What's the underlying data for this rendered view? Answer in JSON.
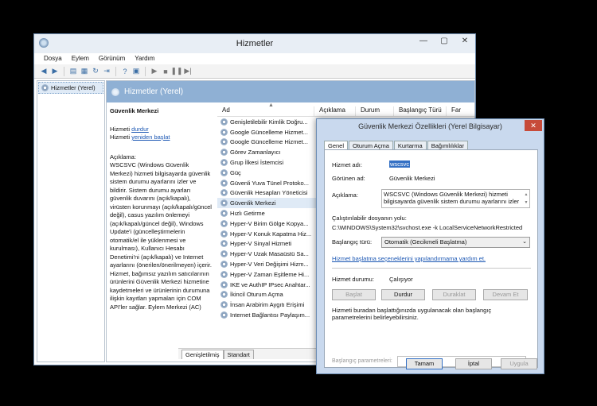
{
  "main": {
    "title": "Hizmetler",
    "menu": [
      "Dosya",
      "Eylem",
      "Görünüm",
      "Yardım"
    ],
    "tree_item": "Hizmetler (Yerel)",
    "content_header": "Hizmetler (Yerel)",
    "desc": {
      "title": "Güvenlik Merkezi",
      "stop_prefix": "Hizmeti ",
      "stop_link": "durdur",
      "restart_prefix": "Hizmeti ",
      "restart_link": "yeniden başlat",
      "label": "Açıklama:",
      "text": "WSCSVC (Windows Güvenlik Merkezi) hizmeti bilgisayarda güvenlik sistem durumu ayarlarını izler ve bildirir. Sistem durumu ayarları güvenlik duvarını (açık/kapalı), virüsten korunmayı (açık/kapalı/güncel değil), casus yazılım önlemeyi (açık/kapalı/güncel değil), Windows Update'i (güncelleştirmelerin otomatik/el ile yüklenmesi ve kurulması), Kullanıcı Hesabı Denetimi'ni (açık/kapalı) ve Internet ayarlarını (önerilen/önerilmeyen) içerir. Hizmet, bağımsız yazılım satıcılarının ürünlerini Güvenlik Merkezi hizmetine kaydetmeleri ve ürünlerinin durumuna ilişkin kayıtları yapmaları için COM API'ler sağlar. Eylem Merkezi (AC)"
    },
    "columns": [
      "Ad",
      "Açıklama",
      "Durum",
      "Başlangıç Türü",
      "Far"
    ],
    "services": [
      "Genişletilebilir Kimlik Doğru...",
      "Google Güncelleme Hizmet...",
      "Google Güncelleme Hizmet...",
      "Görev Zamanlayıcı",
      "Grup İlkesi İstemcisi",
      "Güç",
      "Güvenli Yuva Tünel Protoko...",
      "Güvenlik Hesapları Yöneticisi",
      "Güvenlik Merkezi",
      "Hızlı Getirme",
      "Hyper-V Birim Gölge Kopya...",
      "Hyper-V Konuk Kapatma Hiz...",
      "Hyper-V Sinyal Hizmeti",
      "Hyper-V Uzak Masaüstü Sa...",
      "Hyper-V Veri Değişimi Hizm...",
      "Hyper-V Zaman Eşitleme Hi...",
      "IKE ve AuthIP IPsec Anahtar...",
      "İkincil Oturum Açma",
      "İnsan Arabirim Aygıtı Erişimi",
      "Internet Bağlantısı Paylaşım..."
    ],
    "selected_index": 8,
    "tabs": [
      "Genişletilmiş",
      "Standart"
    ]
  },
  "dialog": {
    "title": "Güvenlik Merkezi Özellikleri (Yerel Bilgisayar)",
    "close": "✕",
    "tabs": [
      "Genel",
      "Oturum Açma",
      "Kurtarma",
      "Bağımlılıklar"
    ],
    "service_name_label": "Hizmet adı:",
    "service_name": "wscsvc",
    "display_name_label": "Görünen ad:",
    "display_name": "Güvenlik Merkezi",
    "description_label": "Açıklama:",
    "description": "WSCSVC (Windows Güvenlik Merkezi) hizmeti bilgisayarda güvenlik sistem durumu ayarlarını izler ve",
    "exec_path_label": "Çalıştırılabilir dosyanın yolu:",
    "exec_path": "C:\\WINDOWS\\System32\\svchost.exe -k LocalServiceNetworkRestricted",
    "startup_type_label": "Başlangıç türü:",
    "startup_type": "Otomatik (Gecikmeli Başlatma)",
    "help_link": "Hizmet başlatma seçeneklerini yapılandırmama yardım et.",
    "status_label": "Hizmet durumu:",
    "status": "Çalışıyor",
    "btn_start": "Başlat",
    "btn_stop": "Durdur",
    "btn_pause": "Duraklat",
    "btn_resume": "Devam Et",
    "note": "Hizmeti buradan başlattığınızda uygulanacak olan başlangıç parametrelerini belirleyebilirsiniz.",
    "params_label": "Başlangıç parametreleri:",
    "btn_ok": "Tamam",
    "btn_cancel": "İptal",
    "btn_apply": "Uygula"
  }
}
